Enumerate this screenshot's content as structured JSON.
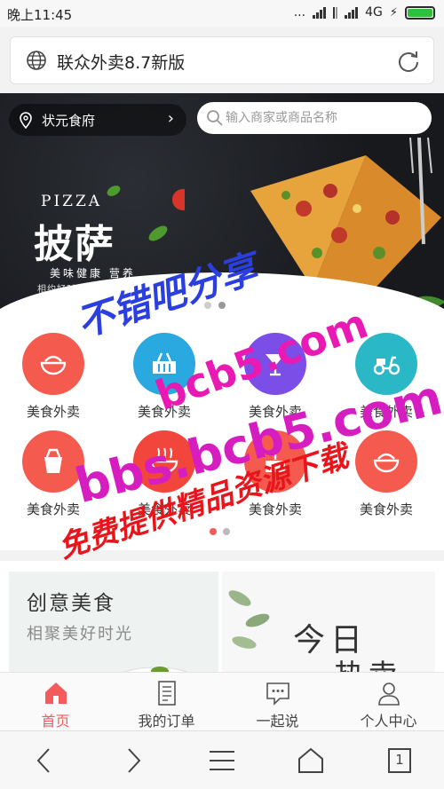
{
  "status_bar": {
    "time": "晚上11:45",
    "dots": "...",
    "network": "4G",
    "battery_level": 1.0
  },
  "browser": {
    "page_title": "联众外卖8.7新版"
  },
  "header": {
    "location": "状元食府",
    "search_placeholder": "输入商家或商品名称"
  },
  "banner": {
    "title_en": "PIZZA",
    "title_cn": "披萨",
    "subtitle": "美味健康 营养",
    "tagline": "相约好时光 相约披萨"
  },
  "categories": [
    {
      "label": "美食外卖",
      "icon": "bowl-icon",
      "color": "#f55a4e"
    },
    {
      "label": "美食外卖",
      "icon": "basket-icon",
      "color": "#2aa8e0"
    },
    {
      "label": "美食外卖",
      "icon": "cocktail-icon",
      "color": "#7b4ee8"
    },
    {
      "label": "美食外卖",
      "icon": "scooter-icon",
      "color": "#2ab7c6"
    },
    {
      "label": "美食外卖",
      "icon": "takeout-box-icon",
      "color": "#f55a4e"
    },
    {
      "label": "美食外卖",
      "icon": "noodle-bowl-icon",
      "color": "#f2453b"
    },
    {
      "label": "美食外卖",
      "icon": "cake-icon",
      "color": "#f55a4e"
    },
    {
      "label": "美食外卖",
      "icon": "bowl-icon",
      "color": "#f55a4e"
    }
  ],
  "promo": {
    "left_title": "创意美食",
    "left_subtitle": "相聚美好时光",
    "right_title_1": "今日",
    "right_title_2": "热卖"
  },
  "tabs": [
    {
      "label": "首页",
      "icon": "home-icon",
      "active": true
    },
    {
      "label": "我的订单",
      "icon": "order-list-icon",
      "active": false
    },
    {
      "label": "一起说",
      "icon": "chat-icon",
      "active": false
    },
    {
      "label": "个人中心",
      "icon": "user-icon",
      "active": false
    }
  ],
  "navbar": {
    "tab_count": "1"
  },
  "watermark": {
    "line1": "不错吧分享",
    "line2": "bcb5.com",
    "line3": "bbs.bcb5.com",
    "line4": "免费提供精品资源下载"
  },
  "colors": {
    "accent": "#f45b5b",
    "dark_banner": "#1d1f24"
  }
}
